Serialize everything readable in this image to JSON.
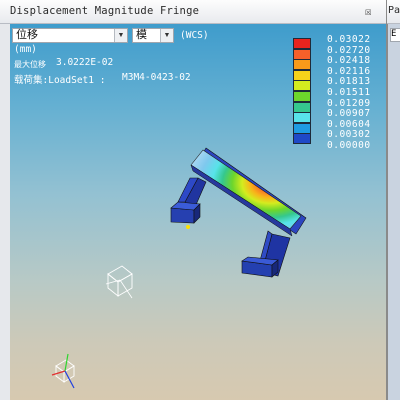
{
  "window": {
    "title": "Displacement Magnitude Fringe",
    "close_glyph": "☒"
  },
  "toolbar": {
    "result_type": "位移",
    "mode": "模",
    "coord_system": "(WCS)"
  },
  "info": {
    "units": "(mm)",
    "max_label": "最大位移",
    "max_value": "3.0222E-02",
    "loadset_label": "载荷集:LoadSet1 :",
    "loadset_value": "M3M4-0423-02"
  },
  "legend": {
    "values": [
      "0.03022",
      "0.02720",
      "0.02418",
      "0.02116",
      "0.01813",
      "0.01511",
      "0.01209",
      "0.00907",
      "0.00604",
      "0.00302",
      "0.00000"
    ],
    "colors": [
      "#e8241e",
      "#f5602a",
      "#f99a1a",
      "#f5d21a",
      "#d4ec1f",
      "#6dd62c",
      "#35c88e",
      "#58e3ea",
      "#1e9be3",
      "#1f49c8",
      "#2a2a80"
    ]
  },
  "right_panel": {
    "title": "Pa",
    "field": "E"
  }
}
